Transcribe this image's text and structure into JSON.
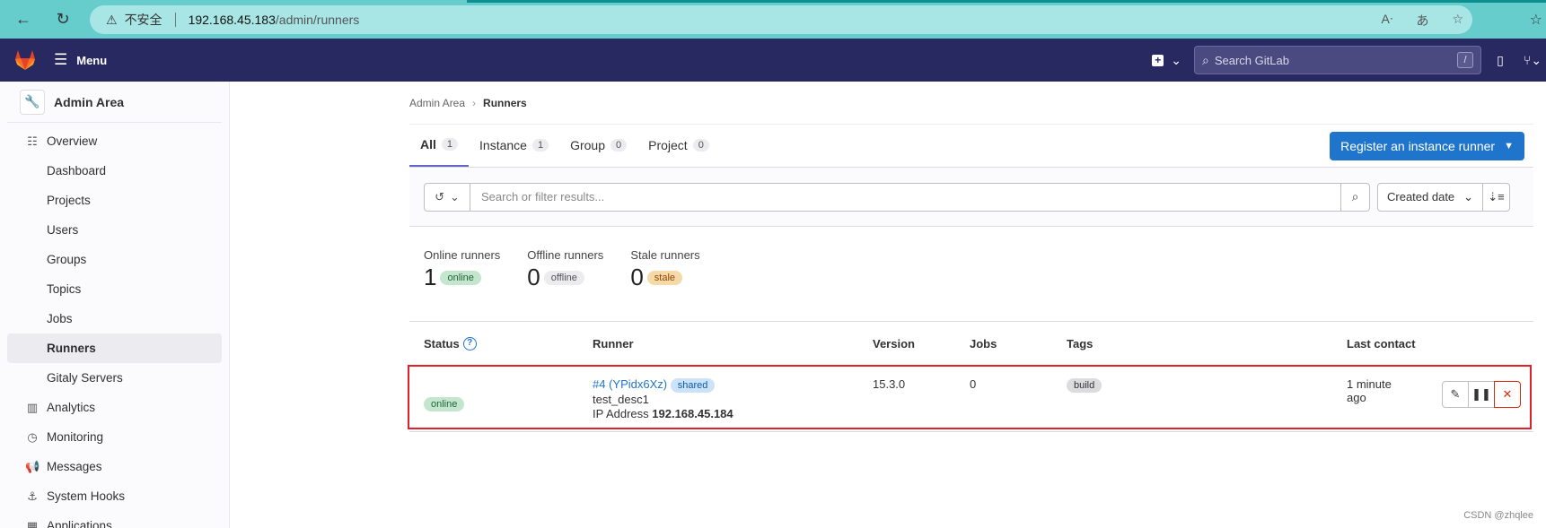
{
  "browser": {
    "insecure_label": "不安全",
    "host": "192.168.45.183",
    "path": "/admin/runners"
  },
  "topnav": {
    "menu_label": "Menu",
    "search_placeholder": "Search GitLab",
    "search_shortcut": "/"
  },
  "sidebar": {
    "title": "Admin Area",
    "items": [
      {
        "label": "Overview",
        "icon": "overview-icon"
      },
      {
        "label": "Dashboard"
      },
      {
        "label": "Projects"
      },
      {
        "label": "Users"
      },
      {
        "label": "Groups"
      },
      {
        "label": "Topics"
      },
      {
        "label": "Jobs"
      },
      {
        "label": "Runners",
        "active": true
      },
      {
        "label": "Gitaly Servers"
      },
      {
        "label": "Analytics",
        "icon": "analytics-icon"
      },
      {
        "label": "Monitoring",
        "icon": "monitoring-icon"
      },
      {
        "label": "Messages",
        "icon": "messages-icon"
      },
      {
        "label": "System Hooks",
        "icon": "hook-icon"
      },
      {
        "label": "Applications",
        "icon": "applications-icon"
      }
    ]
  },
  "breadcrumb": {
    "parent": "Admin Area",
    "current": "Runners"
  },
  "tabs": [
    {
      "label": "All",
      "count": "1"
    },
    {
      "label": "Instance",
      "count": "1"
    },
    {
      "label": "Group",
      "count": "0"
    },
    {
      "label": "Project",
      "count": "0"
    }
  ],
  "register_button": "Register an instance runner",
  "filter": {
    "placeholder": "Search or filter results...",
    "sort_label": "Created date"
  },
  "stats": [
    {
      "label": "Online runners",
      "value": "1",
      "badge": "online"
    },
    {
      "label": "Offline runners",
      "value": "0",
      "badge": "offline"
    },
    {
      "label": "Stale runners",
      "value": "0",
      "badge": "stale"
    }
  ],
  "table": {
    "headers": {
      "status": "Status",
      "runner": "Runner",
      "version": "Version",
      "jobs": "Jobs",
      "tags": "Tags",
      "last_contact": "Last contact"
    },
    "rows": [
      {
        "status": "online",
        "runner_id": "#4 (YPidx6Xz)",
        "runner_type": "shared",
        "description": "test_desc1",
        "ip_label": "IP Address",
        "ip": "192.168.45.184",
        "version": "15.3.0",
        "jobs": "0",
        "tag": "build",
        "last_contact_line1": "1 minute",
        "last_contact_line2": "ago"
      }
    ]
  },
  "watermark": "CSDN @zhqlee",
  "colors": {
    "topnav_bg": "#292961",
    "primary": "#1f75cb",
    "danger": "#dd2b0e",
    "highlight": "#e0202a"
  }
}
